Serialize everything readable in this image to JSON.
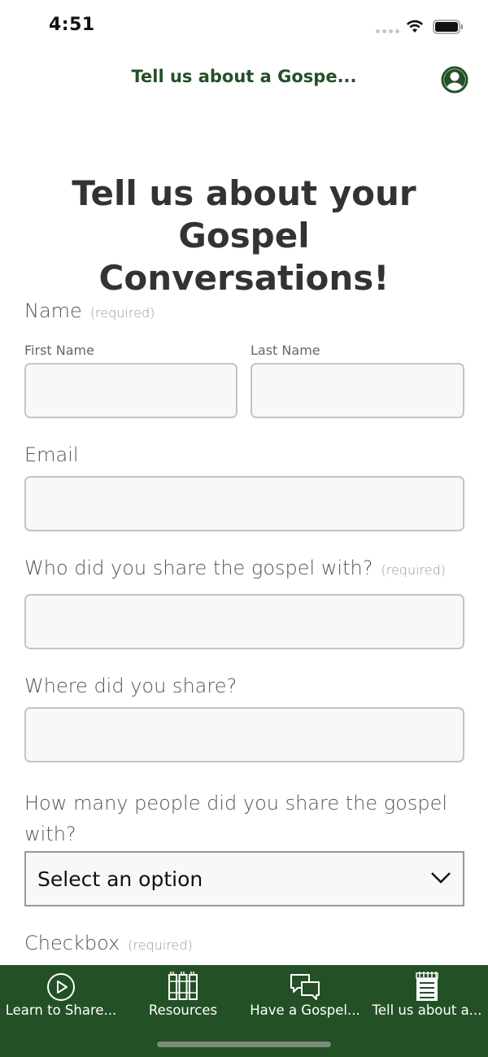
{
  "status_bar": {
    "time": "4:51"
  },
  "nav": {
    "title": "Tell us about a Gospe..."
  },
  "page": {
    "title_line1": "Tell us about your Gospel",
    "title_line2": "Conversations!"
  },
  "form": {
    "name_label": "Name",
    "name_required": "(required)",
    "first_name_label": "First Name",
    "last_name_label": "Last Name",
    "first_name_value": "",
    "last_name_value": "",
    "email_label": "Email",
    "email_value": "",
    "who_label": "Who did you share the gospel with?",
    "who_required": "(required)",
    "who_value": "",
    "where_label": "Where did you share?",
    "where_value": "",
    "how_many_label_line1": "How many people did you share the gospel",
    "how_many_label_line2": "with?",
    "how_many_selected": "Select an option",
    "checkbox_label": "Checkbox",
    "checkbox_required": "(required)"
  },
  "tabs": [
    {
      "label": "Learn to Share...",
      "icon": "play-circle-icon"
    },
    {
      "label": "Resources",
      "icon": "books-icon"
    },
    {
      "label": "Have a Gospel...",
      "icon": "chat-bubbles-icon"
    },
    {
      "label": "Tell us about a...",
      "icon": "notepad-icon"
    }
  ],
  "colors": {
    "brand_green": "#245026",
    "title_text": "#333333"
  }
}
